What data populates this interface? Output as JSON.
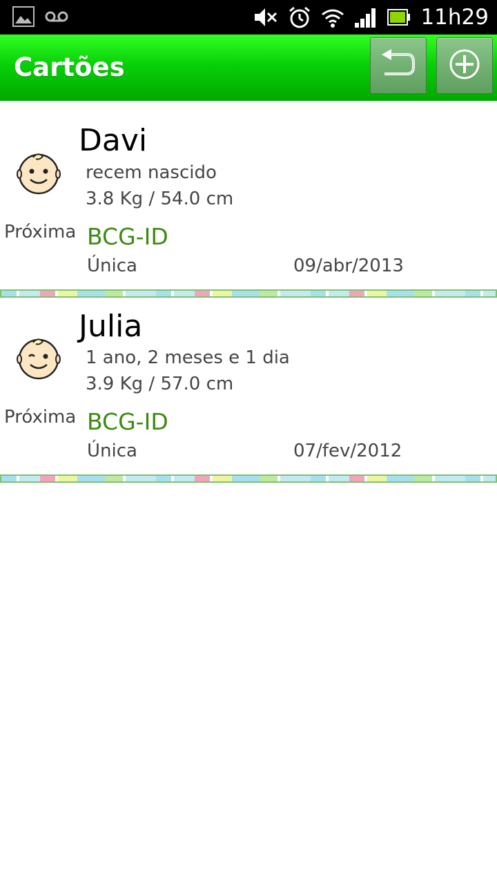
{
  "status_bar": {
    "time": "11h29",
    "icons": [
      "gallery-icon",
      "voicemail-icon",
      "mute-icon",
      "alarm-icon",
      "wifi-icon",
      "signal-icon",
      "battery-icon"
    ]
  },
  "action_bar": {
    "title": "Cartões",
    "buttons": [
      "back-icon",
      "add-circle-icon"
    ],
    "color": "#00c000"
  },
  "cards": [
    {
      "name": "Davi",
      "age": "recem nascido",
      "measure": "3.8 Kg / 54.0 cm",
      "next_label": "Próxima",
      "vaccine": "BCG-ID",
      "dose": "Única",
      "date": "09/abr/2013"
    },
    {
      "name": "Julia",
      "age": "1 ano, 2 meses e 1 dia",
      "measure": "3.9 Kg / 57.0 cm",
      "next_label": "Próxima",
      "vaccine": "BCG-ID",
      "dose": "Única",
      "date": "07/fev/2012"
    }
  ],
  "colors": {
    "vaccine_text": "#3c8a12",
    "divider_border": "#7cc36c"
  }
}
